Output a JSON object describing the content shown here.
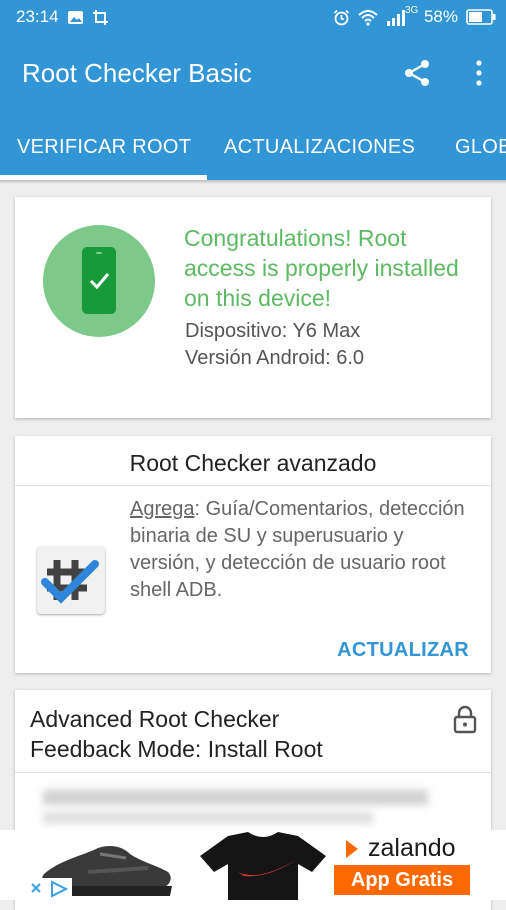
{
  "status_bar": {
    "time": "23:14",
    "network_label": "3G",
    "battery": "58%"
  },
  "app_bar": {
    "title": "Root Checker Basic",
    "actions": [
      "share-icon",
      "more-vert-icon"
    ]
  },
  "tabs": [
    {
      "label": "VERIFICAR ROOT",
      "selected": true
    },
    {
      "label": "ACTUALIZACIONES",
      "selected": false
    },
    {
      "label": "GLOB",
      "selected": false
    }
  ],
  "result_card": {
    "message": "Congratulations! Root access is properly installed on this device!",
    "device_line": "Dispositivo: Y6 Max",
    "android_line": "Versión Android: 6.0"
  },
  "advanced_card": {
    "title": "Root Checker avanzado",
    "adds_label": "Agrega",
    "description": ": Guía/Comentarios, detección binaria de SU y superusuario y versión, y detección de usuario root shell ADB.",
    "action_label": "ACTUALIZAR"
  },
  "feedback_card": {
    "title_line1": "Advanced Root Checker",
    "title_line2": "Feedback Mode: Install Root"
  },
  "ad": {
    "brand": "zalando",
    "cta": "App Gratis"
  },
  "colors": {
    "primary": "#3195d6",
    "success": "#5db962",
    "accent_ad": "#ff6900"
  }
}
